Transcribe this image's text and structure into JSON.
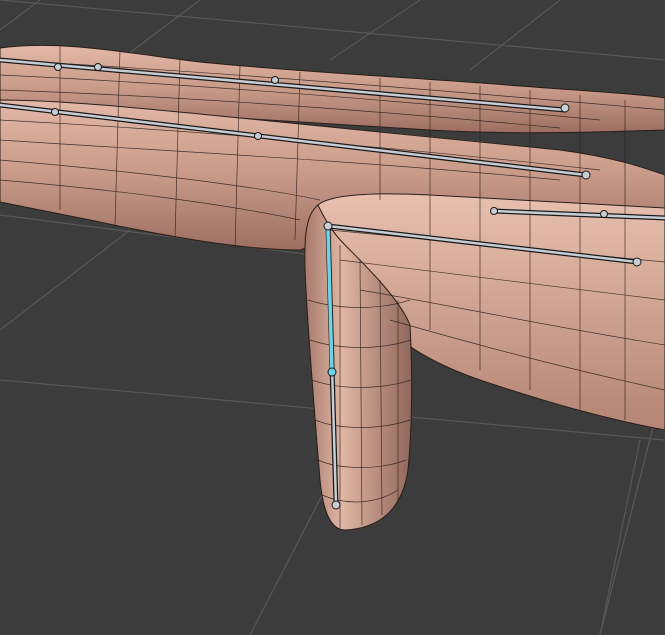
{
  "viewport": {
    "kind": "3d-viewport",
    "background_color": "#3c3c3c",
    "grid_color": "#5a5a5a",
    "mesh_color": "#c99a88",
    "wireframe_color": "#2a1e1a",
    "bone_color": "#c8cdd4",
    "selected_bone_color": "#6fd3e8"
  },
  "scene": {
    "object": "hand-mesh",
    "bones": [
      "finger-bone-1",
      "finger-bone-2",
      "thumb-bone",
      "thumb-bone-selected"
    ]
  }
}
